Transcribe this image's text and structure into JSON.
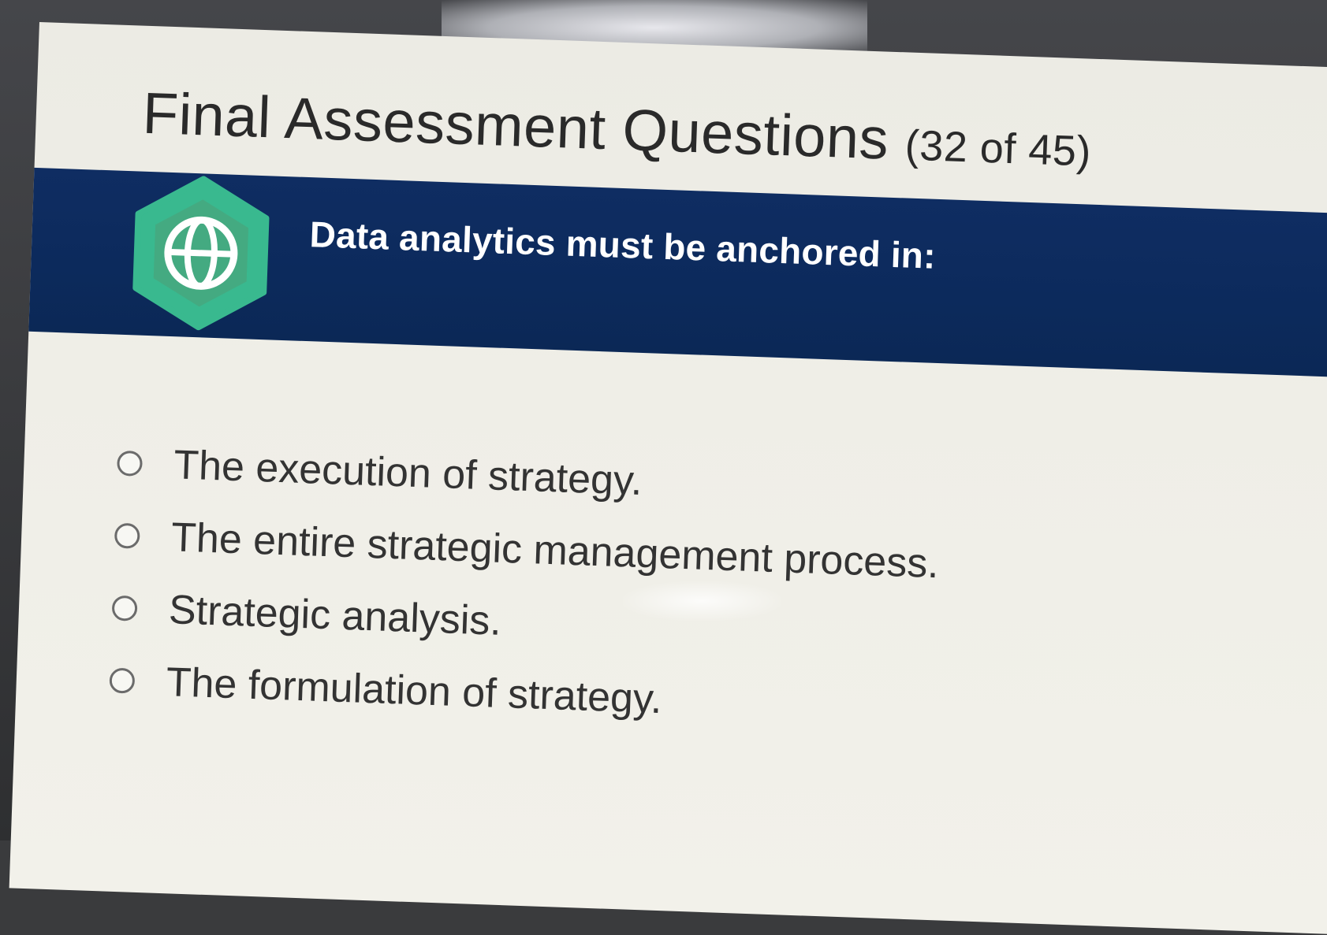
{
  "page": {
    "title": "Final Assessment Questions",
    "counter": "(32 of 45)"
  },
  "question": {
    "text": "Data analytics must be anchored in:",
    "badge_icon": "globe-icon",
    "badge_color": "#39b98f"
  },
  "options": [
    {
      "label": "The execution of strategy."
    },
    {
      "label": "The entire strategic management process."
    },
    {
      "label": "Strategic analysis."
    },
    {
      "label": "The formulation of strategy."
    }
  ],
  "colors": {
    "banner": "#0f2d62",
    "background": "#efeee7",
    "title_text": "#2a2a2a",
    "option_text": "#333333"
  }
}
